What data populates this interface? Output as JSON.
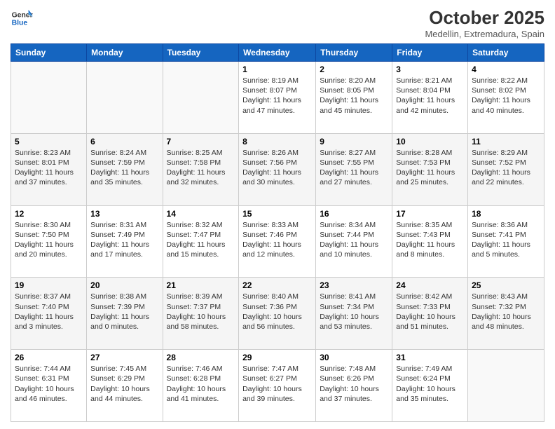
{
  "header": {
    "logo_general": "General",
    "logo_blue": "Blue",
    "month": "October 2025",
    "location": "Medellin, Extremadura, Spain"
  },
  "weekdays": [
    "Sunday",
    "Monday",
    "Tuesday",
    "Wednesday",
    "Thursday",
    "Friday",
    "Saturday"
  ],
  "weeks": [
    [
      {
        "day": "",
        "info": ""
      },
      {
        "day": "",
        "info": ""
      },
      {
        "day": "",
        "info": ""
      },
      {
        "day": "1",
        "info": "Sunrise: 8:19 AM\nSunset: 8:07 PM\nDaylight: 11 hours and 47 minutes."
      },
      {
        "day": "2",
        "info": "Sunrise: 8:20 AM\nSunset: 8:05 PM\nDaylight: 11 hours and 45 minutes."
      },
      {
        "day": "3",
        "info": "Sunrise: 8:21 AM\nSunset: 8:04 PM\nDaylight: 11 hours and 42 minutes."
      },
      {
        "day": "4",
        "info": "Sunrise: 8:22 AM\nSunset: 8:02 PM\nDaylight: 11 hours and 40 minutes."
      }
    ],
    [
      {
        "day": "5",
        "info": "Sunrise: 8:23 AM\nSunset: 8:01 PM\nDaylight: 11 hours and 37 minutes."
      },
      {
        "day": "6",
        "info": "Sunrise: 8:24 AM\nSunset: 7:59 PM\nDaylight: 11 hours and 35 minutes."
      },
      {
        "day": "7",
        "info": "Sunrise: 8:25 AM\nSunset: 7:58 PM\nDaylight: 11 hours and 32 minutes."
      },
      {
        "day": "8",
        "info": "Sunrise: 8:26 AM\nSunset: 7:56 PM\nDaylight: 11 hours and 30 minutes."
      },
      {
        "day": "9",
        "info": "Sunrise: 8:27 AM\nSunset: 7:55 PM\nDaylight: 11 hours and 27 minutes."
      },
      {
        "day": "10",
        "info": "Sunrise: 8:28 AM\nSunset: 7:53 PM\nDaylight: 11 hours and 25 minutes."
      },
      {
        "day": "11",
        "info": "Sunrise: 8:29 AM\nSunset: 7:52 PM\nDaylight: 11 hours and 22 minutes."
      }
    ],
    [
      {
        "day": "12",
        "info": "Sunrise: 8:30 AM\nSunset: 7:50 PM\nDaylight: 11 hours and 20 minutes."
      },
      {
        "day": "13",
        "info": "Sunrise: 8:31 AM\nSunset: 7:49 PM\nDaylight: 11 hours and 17 minutes."
      },
      {
        "day": "14",
        "info": "Sunrise: 8:32 AM\nSunset: 7:47 PM\nDaylight: 11 hours and 15 minutes."
      },
      {
        "day": "15",
        "info": "Sunrise: 8:33 AM\nSunset: 7:46 PM\nDaylight: 11 hours and 12 minutes."
      },
      {
        "day": "16",
        "info": "Sunrise: 8:34 AM\nSunset: 7:44 PM\nDaylight: 11 hours and 10 minutes."
      },
      {
        "day": "17",
        "info": "Sunrise: 8:35 AM\nSunset: 7:43 PM\nDaylight: 11 hours and 8 minutes."
      },
      {
        "day": "18",
        "info": "Sunrise: 8:36 AM\nSunset: 7:41 PM\nDaylight: 11 hours and 5 minutes."
      }
    ],
    [
      {
        "day": "19",
        "info": "Sunrise: 8:37 AM\nSunset: 7:40 PM\nDaylight: 11 hours and 3 minutes."
      },
      {
        "day": "20",
        "info": "Sunrise: 8:38 AM\nSunset: 7:39 PM\nDaylight: 11 hours and 0 minutes."
      },
      {
        "day": "21",
        "info": "Sunrise: 8:39 AM\nSunset: 7:37 PM\nDaylight: 10 hours and 58 minutes."
      },
      {
        "day": "22",
        "info": "Sunrise: 8:40 AM\nSunset: 7:36 PM\nDaylight: 10 hours and 56 minutes."
      },
      {
        "day": "23",
        "info": "Sunrise: 8:41 AM\nSunset: 7:34 PM\nDaylight: 10 hours and 53 minutes."
      },
      {
        "day": "24",
        "info": "Sunrise: 8:42 AM\nSunset: 7:33 PM\nDaylight: 10 hours and 51 minutes."
      },
      {
        "day": "25",
        "info": "Sunrise: 8:43 AM\nSunset: 7:32 PM\nDaylight: 10 hours and 48 minutes."
      }
    ],
    [
      {
        "day": "26",
        "info": "Sunrise: 7:44 AM\nSunset: 6:31 PM\nDaylight: 10 hours and 46 minutes."
      },
      {
        "day": "27",
        "info": "Sunrise: 7:45 AM\nSunset: 6:29 PM\nDaylight: 10 hours and 44 minutes."
      },
      {
        "day": "28",
        "info": "Sunrise: 7:46 AM\nSunset: 6:28 PM\nDaylight: 10 hours and 41 minutes."
      },
      {
        "day": "29",
        "info": "Sunrise: 7:47 AM\nSunset: 6:27 PM\nDaylight: 10 hours and 39 minutes."
      },
      {
        "day": "30",
        "info": "Sunrise: 7:48 AM\nSunset: 6:26 PM\nDaylight: 10 hours and 37 minutes."
      },
      {
        "day": "31",
        "info": "Sunrise: 7:49 AM\nSunset: 6:24 PM\nDaylight: 10 hours and 35 minutes."
      },
      {
        "day": "",
        "info": ""
      }
    ]
  ]
}
